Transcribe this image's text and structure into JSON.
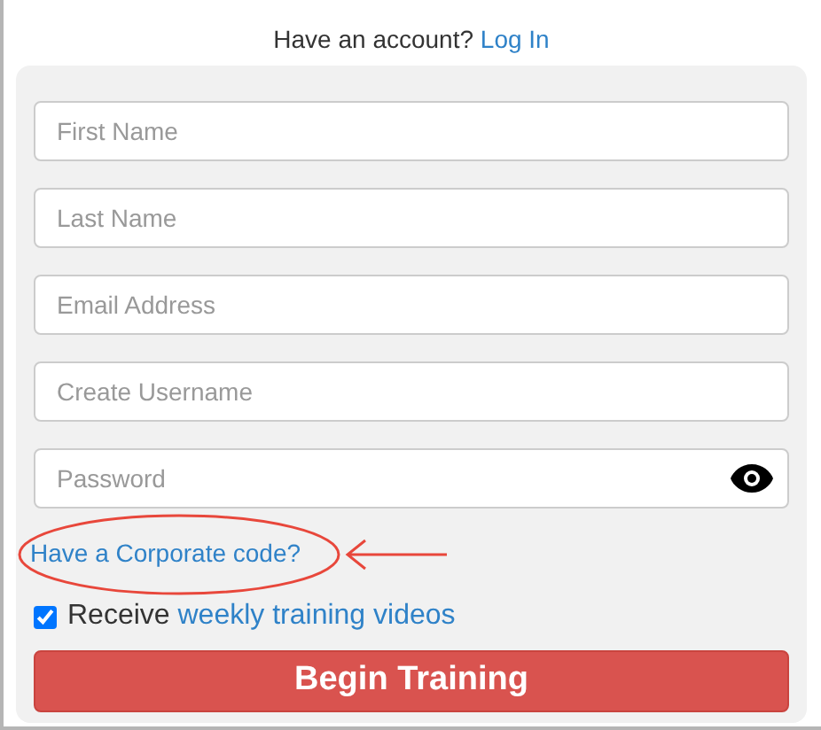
{
  "header": {
    "text": "Have an account?",
    "link": "Log In"
  },
  "fields": [
    {
      "placeholder": "First Name",
      "kind": "text"
    },
    {
      "placeholder": "Last Name",
      "kind": "text"
    },
    {
      "placeholder": "Email Address",
      "kind": "text"
    },
    {
      "placeholder": "Create Username",
      "kind": "text"
    },
    {
      "placeholder": "Password",
      "kind": "password"
    }
  ],
  "corporate_link": {
    "text": "Have a Corporate code?",
    "circled": true
  },
  "newsletter": {
    "text": "Receive",
    "link": "weekly training videos",
    "checked": true
  },
  "submit": {
    "label": "Begin Training"
  }
}
